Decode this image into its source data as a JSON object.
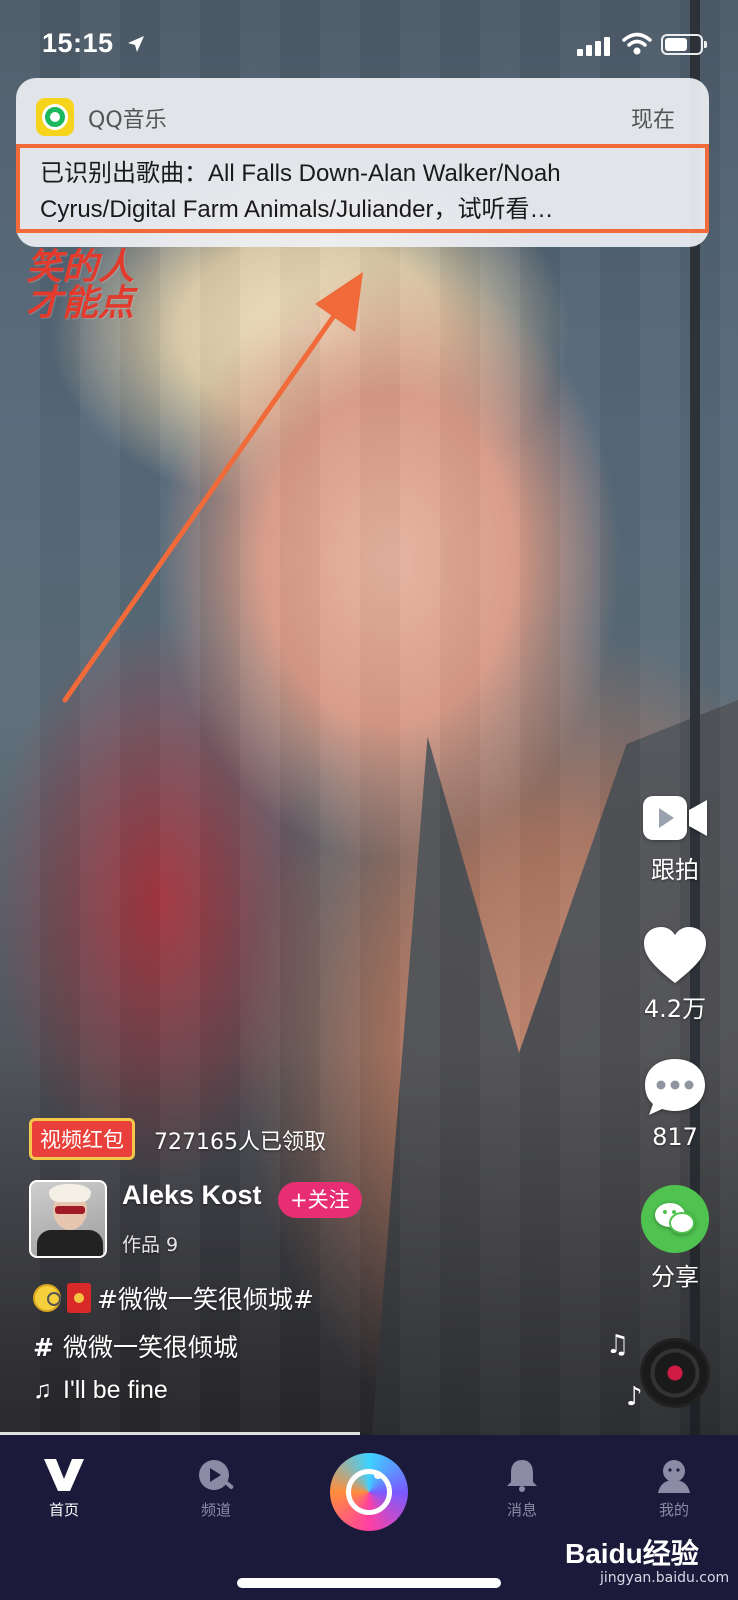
{
  "status_bar": {
    "time": "15:15"
  },
  "notification": {
    "app_name": "QQ音乐",
    "time": "现在",
    "message_line1": "已识别出歌曲：All Falls Down-Alan Walker/Noah",
    "message_line2": "Cyrus/Digital Farm Animals/Juliander，试听看…"
  },
  "sticker": {
    "line1": "笑的人",
    "line2": "才能点"
  },
  "actions": {
    "duet_label": "跟拍",
    "like_count": "4.2万",
    "comment_count": "817",
    "share_label": "分享"
  },
  "video_info": {
    "red_packet_badge": "视频红包",
    "red_packet_claimed": "727165人已领取",
    "author": "Aleks Kost",
    "follow_label": "+关注",
    "works": "作品 9",
    "caption": "#微微一笑很倾城#",
    "topic": "微微一笑很倾城",
    "song": "I'll be fine"
  },
  "tab_bar": {
    "tabs": [
      {
        "label": "首页",
        "icon": "v-logo-icon",
        "active": true
      },
      {
        "label": "频道",
        "icon": "channel-icon",
        "active": false
      },
      {
        "label": "消息",
        "icon": "bell-icon",
        "active": false
      },
      {
        "label": "我的",
        "icon": "profile-icon",
        "active": false
      }
    ]
  },
  "watermark": {
    "brand": "Baidu经验",
    "url": "jingyan.baidu.com"
  },
  "colors": {
    "accent_follow": "#e82e73",
    "red_packet": "#e9403b",
    "annotation": "#f06a3a",
    "tab_bar_bg": "#1c1a3b",
    "wechat_green": "#4fc24f"
  }
}
